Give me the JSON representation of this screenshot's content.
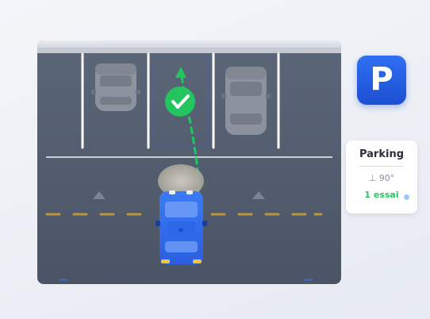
{
  "scene": {
    "colors": {
      "asphalt": "#505b6e",
      "stall_line": "#ffffff",
      "center_dash": "#b8963c",
      "player_car": "#2f6ff3",
      "ghost_car": "#b3b6bc",
      "success": "#22c55e",
      "path": "#22c55e"
    },
    "target_icon": "checkmark-icon"
  },
  "badge": {
    "letter": "P",
    "icon": "parking-icon"
  },
  "card": {
    "title": "Parking",
    "angle": "⊥ 90°",
    "attempts": "1 essai"
  }
}
